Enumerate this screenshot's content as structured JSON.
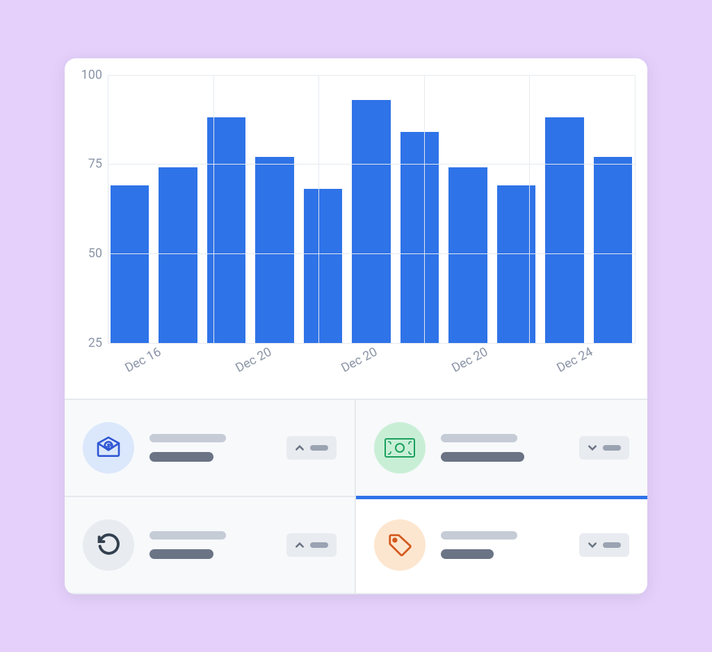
{
  "chart_data": {
    "type": "bar",
    "ylim": [
      25,
      100
    ],
    "y_ticks": [
      100,
      75,
      50,
      25
    ],
    "x_ticks": [
      {
        "label": "Dec 16",
        "pos_pct": 3
      },
      {
        "label": "Dec 20",
        "pos_pct": 24
      },
      {
        "label": "Dec 20",
        "pos_pct": 44
      },
      {
        "label": "Dec 20",
        "pos_pct": 65
      },
      {
        "label": "Dec 24",
        "pos_pct": 85
      }
    ],
    "x_grid_pct": [
      0,
      20,
      40,
      60,
      80,
      100
    ],
    "values": [
      69,
      74,
      88,
      77,
      68,
      93,
      84,
      74,
      69,
      88,
      77
    ]
  },
  "stats": [
    {
      "icon": "envelope-dollar",
      "circle": "icon-blue",
      "trend": "up",
      "active": false
    },
    {
      "icon": "cash",
      "circle": "icon-green",
      "trend": "down",
      "active": false
    },
    {
      "icon": "undo",
      "circle": "icon-gray",
      "trend": "up",
      "active": false
    },
    {
      "icon": "tag",
      "circle": "icon-orange",
      "trend": "down",
      "active": true
    }
  ],
  "colors": {
    "bar": "#2f73e8",
    "accent": "#2f73e8",
    "card_bg": "#ffffff",
    "page_bg": "#e4d0fa"
  }
}
